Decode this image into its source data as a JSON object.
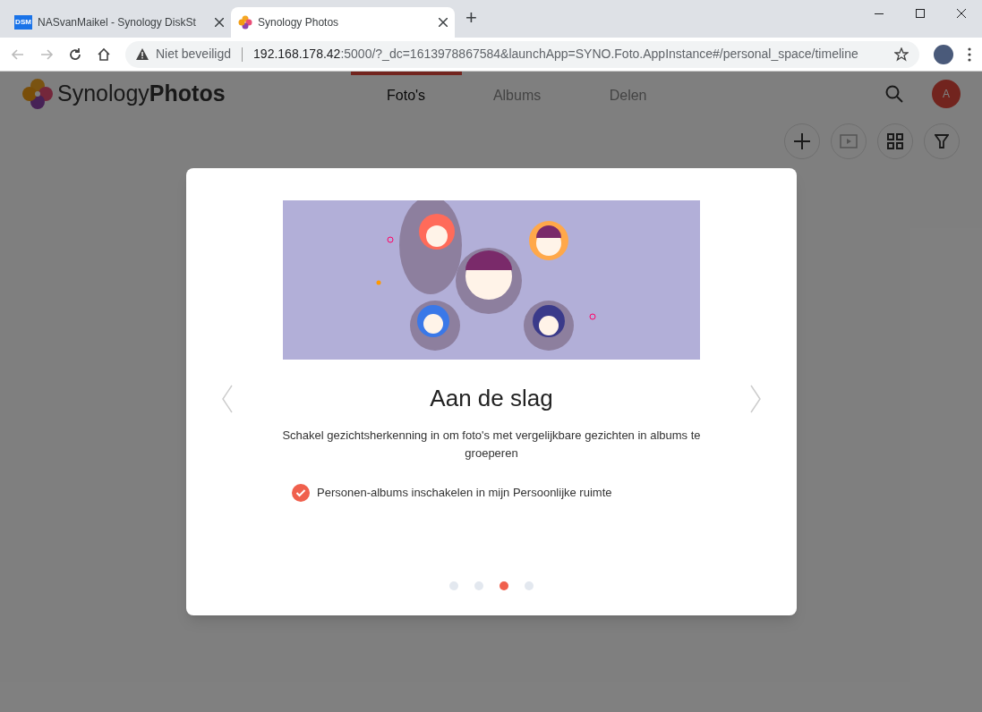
{
  "browser": {
    "tabs": [
      {
        "title": "NASvanMaikel - Synology DiskSt",
        "favicon_text": "DSM",
        "selected": false
      },
      {
        "title": "Synology Photos",
        "selected": true
      }
    ],
    "new_tab": "+",
    "security": "Niet beveiligd",
    "url_host": "192.168.178.42",
    "url_rest": ":5000/?_dc=1613978867584&launchApp=SYNO.Foto.AppInstance#/personal_space/timeline"
  },
  "app": {
    "logo_light": "Synology",
    "logo_bold": "Photos",
    "nav": [
      {
        "label": "Foto's",
        "selected": true
      },
      {
        "label": "Albums",
        "selected": false
      },
      {
        "label": "Delen",
        "selected": false
      }
    ],
    "avatar": "A"
  },
  "dialog": {
    "title": "Aan de slag",
    "description": "Schakel gezichtsherkenning in om foto's met vergelijkbare gezichten in albums te groeperen",
    "option": {
      "label": "Personen-albums inschakelen in mijn Persoonlijke ruimte",
      "checked": true
    },
    "pages": [
      {
        "selected": false
      },
      {
        "selected": false
      },
      {
        "selected": true
      },
      {
        "selected": false
      }
    ]
  }
}
